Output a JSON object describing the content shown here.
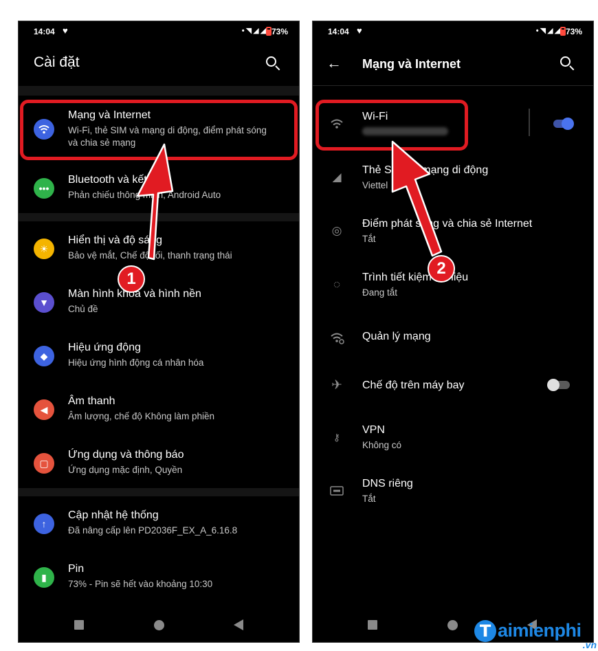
{
  "status_bar": {
    "time": "14:04",
    "battery": "73%"
  },
  "left": {
    "title": "Cài đặt",
    "items": [
      {
        "title": "Mạng và Internet",
        "subtitle": "Wi-Fi, thẻ SIM và mạng di động, điểm phát sóng",
        "subtitle2": "và chia sẻ mạng",
        "icon": "wifi-icon",
        "color": "#3d63e0"
      },
      {
        "title": "Bluetooth và kết nối",
        "subtitle": "Phản chiếu thông minh, Android Auto",
        "icon": "bluetooth-icon",
        "color": "#2fb34a"
      },
      {
        "title": "Hiển thị và độ sáng",
        "subtitle": "Bảo vệ mắt, Chế độ tối, thanh trạng thái",
        "icon": "brightness-icon",
        "color": "#f4b400"
      },
      {
        "title": "Màn hình khóa và hình nền",
        "subtitle": "Chủ đề",
        "icon": "theme-icon",
        "color": "#5b4fcf"
      },
      {
        "title": "Hiệu ứng động",
        "subtitle": "Hiệu ứng hình động cá nhân hóa",
        "icon": "animation-icon",
        "color": "#3d63e0"
      },
      {
        "title": "Âm thanh",
        "subtitle": "Âm lượng, chế độ Không làm phiền",
        "icon": "sound-icon",
        "color": "#e5533d"
      },
      {
        "title": "Ứng dụng và thông báo",
        "subtitle": "Ứng dụng mặc định, Quyền",
        "icon": "apps-icon",
        "color": "#e5533d"
      },
      {
        "title": "Cập nhật hệ thống",
        "subtitle": "Đã nâng cấp lên PD2036F_EX_A_6.16.8",
        "icon": "update-icon",
        "color": "#3d63e0"
      },
      {
        "title": "Pin",
        "subtitle": "73% - Pin sẽ hết vào khoảng 10:30",
        "icon": "battery-icon",
        "color": "#2fb34a"
      }
    ]
  },
  "right": {
    "title": "Mạng và Internet",
    "items": [
      {
        "title": "Wi-Fi",
        "subtitle": "",
        "icon": "wifi-icon",
        "toggle": true
      },
      {
        "title": "Thẻ SIM và mạng di động",
        "subtitle": "Viettel",
        "icon": "signal-icon"
      },
      {
        "title": "Điểm phát sóng và chia sẻ Internet",
        "subtitle": "Tắt",
        "icon": "hotspot-icon"
      },
      {
        "title": "Trình tiết kiệm dữ liệu",
        "subtitle": "Đang tắt",
        "icon": "data-saver-icon"
      },
      {
        "title": "Quản lý mạng",
        "subtitle": "",
        "icon": "network-manage-icon"
      },
      {
        "title": "Chế độ trên máy bay",
        "subtitle": "",
        "icon": "airplane-icon",
        "toggle": false
      },
      {
        "title": "VPN",
        "subtitle": "Không có",
        "icon": "vpn-key-icon"
      },
      {
        "title": "DNS riêng",
        "subtitle": "Tắt",
        "icon": "dns-icon"
      }
    ]
  },
  "annotations": {
    "step1": "1",
    "step2": "2",
    "color": "#e11b22"
  },
  "accent": "#3d63e0",
  "watermark": {
    "logo": "T",
    "text": "aimienphi",
    "domain": ".vn"
  }
}
